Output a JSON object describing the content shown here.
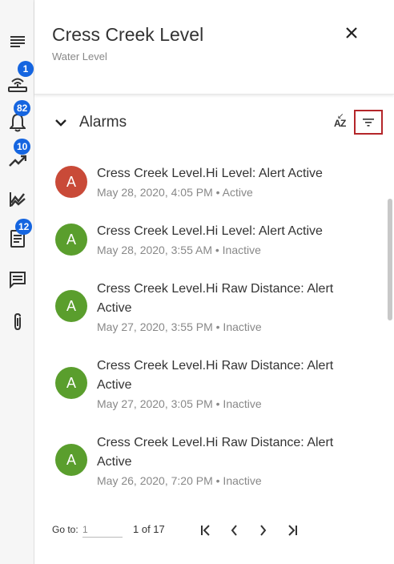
{
  "rail": {
    "items": [
      {
        "name": "menu",
        "badge": null
      },
      {
        "name": "device",
        "badge": "1"
      },
      {
        "name": "alarms",
        "badge": "82"
      },
      {
        "name": "trends",
        "badge": "10"
      },
      {
        "name": "analytics",
        "badge": null
      },
      {
        "name": "reports",
        "badge": "12"
      },
      {
        "name": "messages",
        "badge": null
      },
      {
        "name": "attachments",
        "badge": null
      }
    ]
  },
  "header": {
    "title": "Cress Creek Level",
    "subtitle": "Water Level"
  },
  "section": {
    "title": "Alarms",
    "sort_a": "A",
    "sort_z": "Z"
  },
  "alarms": [
    {
      "avatar": "A",
      "avatar_color": "#c94a38",
      "title": "Cress Creek Level.Hi Level: Alert Active",
      "meta": "May 28, 2020, 4:05 PM • Active"
    },
    {
      "avatar": "A",
      "avatar_color": "#5a9e2d",
      "title": "Cress Creek Level.Hi Level: Alert Active",
      "meta": "May 28, 2020, 3:55 AM • Inactive"
    },
    {
      "avatar": "A",
      "avatar_color": "#5a9e2d",
      "title": "Cress Creek Level.Hi Raw Distance: Alert Active",
      "meta": "May 27, 2020, 3:55 PM • Inactive"
    },
    {
      "avatar": "A",
      "avatar_color": "#5a9e2d",
      "title": "Cress Creek Level.Hi Raw Distance: Alert Active",
      "meta": "May 27, 2020, 3:05 PM • Inactive"
    },
    {
      "avatar": "A",
      "avatar_color": "#5a9e2d",
      "title": "Cress Creek Level.Hi Raw Distance: Alert Active",
      "meta": "May 26, 2020, 7:20 PM • Inactive"
    }
  ],
  "pager": {
    "goto_label": "Go to:",
    "goto_value": "1",
    "page_of": "1 of 17"
  },
  "colors": {
    "badge": "#1565e0",
    "filter_highlight": "#b4262a"
  }
}
